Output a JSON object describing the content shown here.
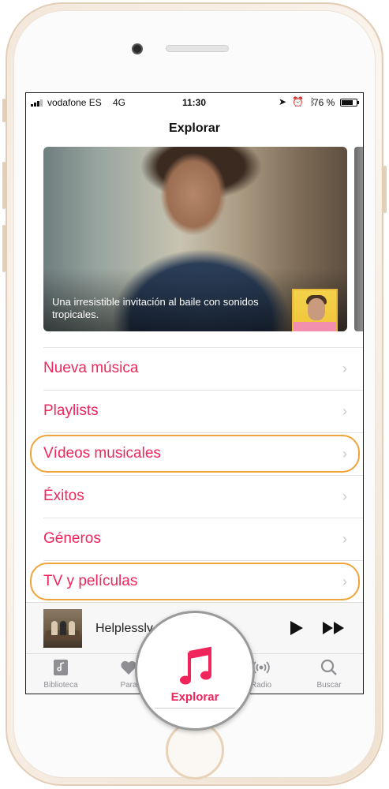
{
  "status_bar": {
    "carrier": "vodafone ES",
    "network": "4G",
    "time": "11:30",
    "battery_percent": "76 %",
    "battery_level": 0.76,
    "icons": [
      "location-icon",
      "alarm-icon",
      "bluetooth-icon"
    ]
  },
  "header": {
    "title": "Explorar"
  },
  "hero": {
    "caption": "Una irresistible invitación al baile con sonidos tropicales."
  },
  "menu": {
    "items": [
      {
        "label": "Nueva música",
        "highlighted": false
      },
      {
        "label": "Playlists",
        "highlighted": false
      },
      {
        "label": "Vídeos musicales",
        "highlighted": true
      },
      {
        "label": "Éxitos",
        "highlighted": false
      },
      {
        "label": "Géneros",
        "highlighted": false
      },
      {
        "label": "TV y películas",
        "highlighted": true
      }
    ],
    "chevron": "›"
  },
  "mini_player": {
    "title": "Helplessly"
  },
  "tab_bar": {
    "tabs": [
      {
        "label": "Biblioteca",
        "icon": "library-icon"
      },
      {
        "label": "Para",
        "icon": "heart-icon"
      },
      {
        "label": "Explorar",
        "icon": "music-note-icon",
        "selected": true
      },
      {
        "label": "Radio",
        "icon": "radio-icon"
      },
      {
        "label": "Buscar",
        "icon": "search-icon"
      }
    ]
  },
  "colors": {
    "accent": "#f0255b",
    "highlight_ring": "#f2a43c",
    "chevron": "#c7c7cc",
    "tab_inactive": "#8e8e93"
  }
}
